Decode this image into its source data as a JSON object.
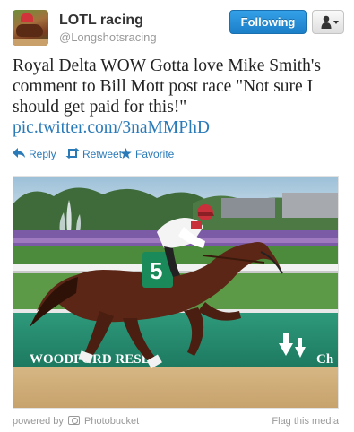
{
  "user": {
    "name": "LOTL racing",
    "handle": "@Longshotsracing"
  },
  "buttons": {
    "follow_label": "Following",
    "user_menu_icon": "person-icon"
  },
  "tweet": {
    "text": "Royal Delta WOW Gotta love Mike Smith's comment to Bill Mott post race \"Not sure I should get paid for this!\"",
    "link_text": "pic.twitter.com/3naMMPhD"
  },
  "actions": {
    "reply": "Reply",
    "retweet": "Retweet",
    "favorite": "Favorite"
  },
  "photo": {
    "saddle_number": "5",
    "rail_sign": "WOODFORD RESE",
    "rail_sign_right": "Ch"
  },
  "footer": {
    "powered_by": "powered by",
    "provider": "Photobucket",
    "flag": "Flag this media"
  },
  "colors": {
    "link": "#2a7ab8",
    "follow_button": "#1c7fc8"
  }
}
